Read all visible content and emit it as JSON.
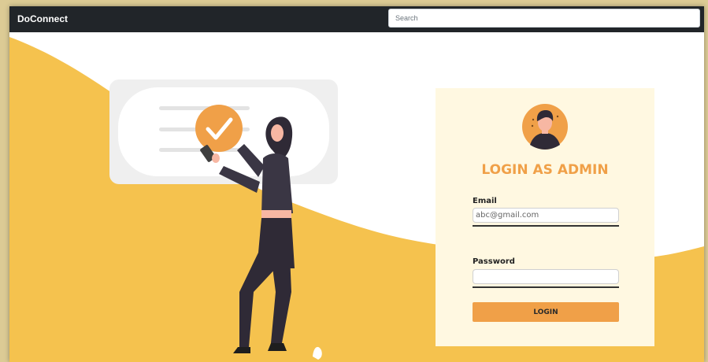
{
  "navbar": {
    "brand": "DoConnect",
    "search_placeholder": "Search"
  },
  "login": {
    "title": "LOGIN AS ADMIN",
    "email_label": "Email",
    "email_value": "abc@gmail.com",
    "password_label": "Password",
    "password_value": "",
    "button_label": "LOGIN"
  },
  "colors": {
    "navbar": "#212529",
    "accent": "#f0a048",
    "wave": "#f5c24e",
    "card": "#fff8e1"
  }
}
